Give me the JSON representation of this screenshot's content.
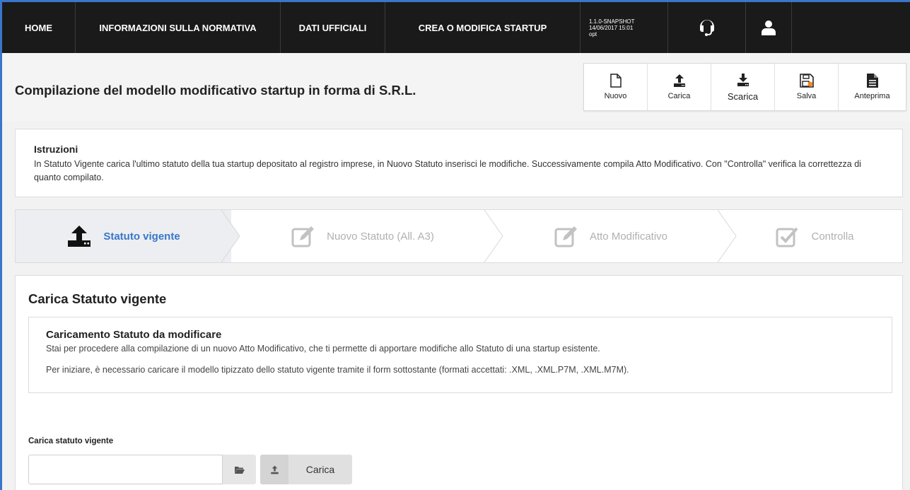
{
  "nav": {
    "items": [
      {
        "label": "HOME"
      },
      {
        "label": "INFORMAZIONI SULLA NORMATIVA"
      },
      {
        "label": "DATI UFFICIALI"
      },
      {
        "label": "CREA O MODIFICA STARTUP"
      }
    ],
    "version": {
      "line1": "1.1.0-SNAPSHOT",
      "line2": "14/06/2017 15:01",
      "line3": "opt"
    },
    "support_icon": "headset-icon",
    "user_icon": "user-icon"
  },
  "header": {
    "title": "Compilazione del modello modificativo startup in forma di S.R.L.",
    "toolbar": {
      "nuovo": "Nuovo",
      "carica": "Carica",
      "scarica": "Scarica",
      "salva": "Salva",
      "anteprima": "Anteprima"
    }
  },
  "instructions": {
    "title": "Istruzioni",
    "text": "In Statuto Vigente carica l'ultimo statuto della tua startup depositato al registro imprese, in Nuovo Statuto inserisci le modifiche. Successivamente compila Atto Modificativo. Con \"Controlla\" verifica la correttezza di quanto compilato."
  },
  "steps": [
    {
      "label": "Statuto vigente",
      "icon": "upload-icon",
      "active": true
    },
    {
      "label": "Nuovo Statuto (All. A3)",
      "icon": "edit-icon",
      "active": false
    },
    {
      "label": "Atto Modificativo",
      "icon": "edit-icon",
      "active": false
    },
    {
      "label": "Controlla",
      "icon": "check-icon",
      "active": false
    }
  ],
  "main": {
    "title": "Carica Statuto vigente",
    "notice": {
      "title": "Caricamento Statuto da modificare",
      "line1": "Stai per procedere alla compilazione di un nuovo Atto Modificativo, che ti permette di apportare modifiche allo Statuto di una startup esistente.",
      "line2": "Per iniziare, è necessario caricare il modello tipizzato dello statuto vigente tramite il form sottostante (formati accettati: .XML, .XML.P7M, .XML.M7M)."
    },
    "upload": {
      "label": "Carica statuto vigente",
      "value": "",
      "button": "Carica"
    }
  },
  "colors": {
    "navbar": "#1a1a1a",
    "accent": "#3a76c9",
    "inactive_step": "#b0b0b0",
    "background": "#f2f2f2"
  }
}
